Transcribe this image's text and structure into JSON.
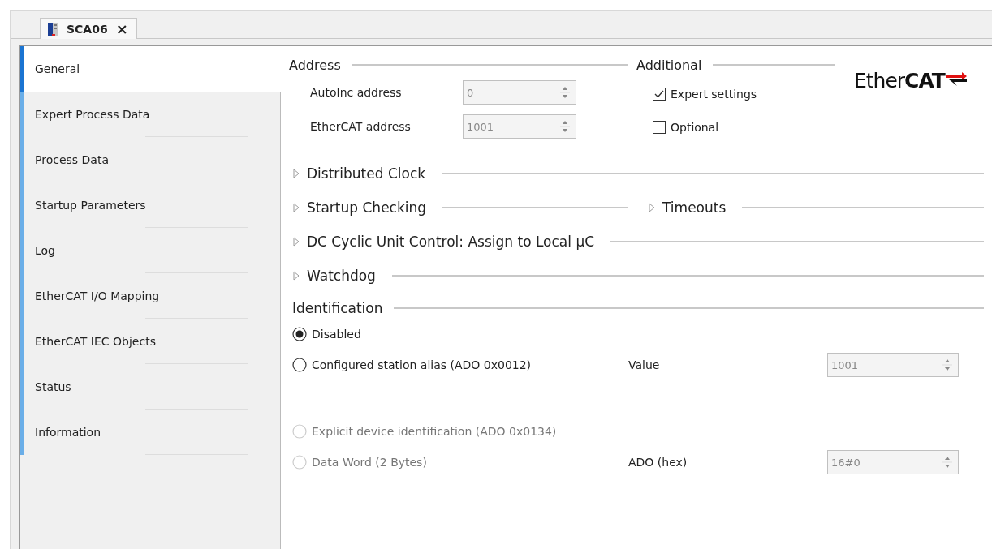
{
  "editor_tab": {
    "title": "SCA06",
    "close": "×"
  },
  "sidebar": {
    "items": [
      {
        "label": "General",
        "selected": true
      },
      {
        "label": "Expert Process Data",
        "selected": false
      },
      {
        "label": "Process Data",
        "selected": false
      },
      {
        "label": "Startup Parameters",
        "selected": false
      },
      {
        "label": "Log",
        "selected": false
      },
      {
        "label": "EtherCAT I/O Mapping",
        "selected": false
      },
      {
        "label": "EtherCAT IEC Objects",
        "selected": false
      },
      {
        "label": "Status",
        "selected": false
      },
      {
        "label": "Information",
        "selected": false
      }
    ]
  },
  "address": {
    "title": "Address",
    "fields": [
      {
        "label": "AutoInc address",
        "value": "0",
        "disabled": true
      },
      {
        "label": "EtherCAT address",
        "value": "1001",
        "disabled": true
      }
    ]
  },
  "additional": {
    "title": "Additional",
    "options": [
      {
        "label": "Expert settings",
        "checked": true
      },
      {
        "label": "Optional",
        "checked": false
      }
    ]
  },
  "logo": {
    "text": "Ether**CAT**"
  },
  "collapsible_rows": [
    [
      {
        "label": "Distributed Clock",
        "expanded": false
      }
    ],
    [
      {
        "label": "Startup Checking",
        "expanded": false
      },
      {
        "label": "Timeouts",
        "expanded": false
      }
    ],
    [
      {
        "label": "DC Cyclic Unit Control: Assign to Local µC",
        "expanded": false
      }
    ],
    [
      {
        "label": "Watchdog",
        "expanded": false
      }
    ]
  ],
  "identification": {
    "title": "Identification",
    "options": [
      {
        "label": "Disabled",
        "selected": true,
        "disabled": false
      },
      {
        "label": "Configured station alias (ADO 0x0012)",
        "selected": false,
        "disabled": false,
        "field_label": "Value",
        "field_value": "1001"
      },
      {
        "label": "Explicit device identification (ADO 0x0134)",
        "selected": false,
        "disabled": true
      },
      {
        "label": "Data Word (2 Bytes)",
        "selected": false,
        "disabled": true,
        "field_label": "ADO (hex)",
        "field_value": "16#0"
      }
    ]
  }
}
